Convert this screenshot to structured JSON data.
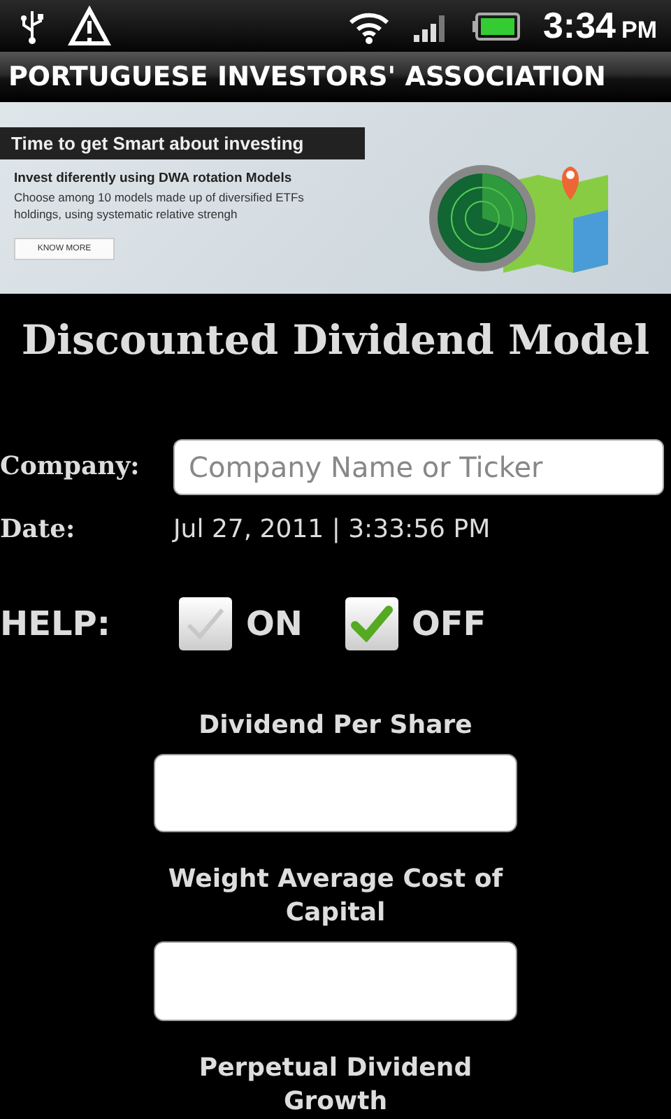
{
  "status_bar": {
    "time": "3:34",
    "ampm": "PM"
  },
  "app_title": "PORTUGUESE INVESTORS' ASSOCIATION",
  "banner": {
    "headline": "Time to get Smart about investing",
    "subhead": "Invest diferently using DWA rotation Models",
    "body": "Choose among 10 models made up of diversified ETFs holdings, using systematic relative strengh",
    "button": "KNOW MORE"
  },
  "heading": "Discounted Dividend Model",
  "company": {
    "label": "Company:",
    "placeholder": "Company Name or Ticker"
  },
  "date": {
    "label": "Date:",
    "value": "Jul 27, 2011 | 3:33:56 PM"
  },
  "help": {
    "label": "HELP:",
    "options": [
      {
        "label": "ON",
        "checked": false
      },
      {
        "label": "OFF",
        "checked": true
      }
    ]
  },
  "fields": [
    {
      "label": "Dividend Per Share"
    },
    {
      "label": "Weight Average Cost of Capital"
    },
    {
      "label": "Perpetual Dividend Growth"
    }
  ]
}
